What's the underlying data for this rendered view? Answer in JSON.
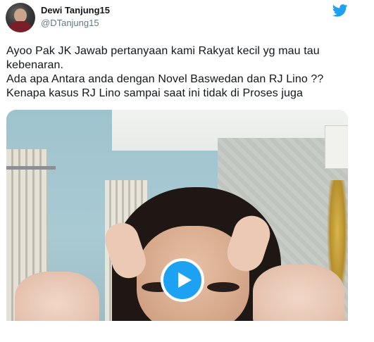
{
  "user": {
    "display_name": "Dewi Tanjung15",
    "handle": "@DTanjung15"
  },
  "tweet": {
    "lines": [
      "Ayoo Pak JK Jawab pertanyaan kami Rakyat kecil yg mau tau",
      "kebenaran.",
      "Ada apa Antara anda dengan Novel Baswedan dan RJ Lino ??",
      "Kenapa kasus RJ Lino sampai saat ini tidak di Proses juga"
    ]
  },
  "icons": {
    "brand": "twitter-bird-icon",
    "media_control": "play-icon"
  },
  "colors": {
    "brand": "#1da1f2",
    "text": "#14171a",
    "handle": "#657786"
  }
}
